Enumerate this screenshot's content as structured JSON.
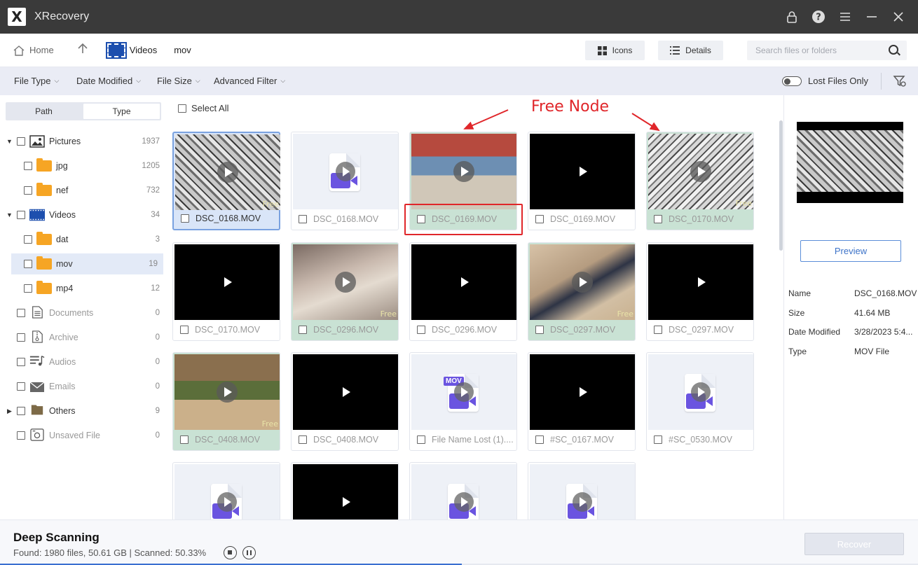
{
  "app": {
    "title": "XRecovery",
    "logo_letter": "X"
  },
  "window_controls": [
    "lock-icon",
    "help-icon",
    "menu-icon",
    "minimize-icon",
    "close-icon"
  ],
  "nav": {
    "home_label": "Home",
    "breadcrumb": [
      "Videos",
      "mov"
    ],
    "icons_view_label": "Icons",
    "details_view_label": "Details",
    "search_placeholder": "Search files or folders"
  },
  "filters": {
    "file_type": "File Type",
    "date_modified": "Date Modified",
    "file_size": "File Size",
    "advanced": "Advanced Filter",
    "lost_files_only": "Lost Files Only",
    "lost_files_only_enabled": false
  },
  "sidebar": {
    "segments": [
      "Path",
      "Type"
    ],
    "active_segment": "Type",
    "tree": [
      {
        "label": "Pictures",
        "count": "1937",
        "icon": "picture-icon",
        "level": 0,
        "expanded": true
      },
      {
        "label": "jpg",
        "count": "1205",
        "icon": "folder-icon",
        "level": 1
      },
      {
        "label": "nef",
        "count": "732",
        "icon": "folder-icon",
        "level": 1
      },
      {
        "label": "Videos",
        "count": "34",
        "icon": "video-icon",
        "level": 0,
        "expanded": true
      },
      {
        "label": "dat",
        "count": "3",
        "icon": "folder-icon",
        "level": 1
      },
      {
        "label": "mov",
        "count": "19",
        "icon": "folder-icon",
        "level": 1,
        "selected": true
      },
      {
        "label": "mp4",
        "count": "12",
        "icon": "folder-icon",
        "level": 1
      },
      {
        "label": "Documents",
        "count": "0",
        "icon": "document-icon",
        "level": 0,
        "dim": true
      },
      {
        "label": "Archive",
        "count": "0",
        "icon": "archive-icon",
        "level": 0,
        "dim": true
      },
      {
        "label": "Audios",
        "count": "0",
        "icon": "audio-icon",
        "level": 0,
        "dim": true
      },
      {
        "label": "Emails",
        "count": "0",
        "icon": "email-icon",
        "level": 0,
        "dim": true
      },
      {
        "label": "Others",
        "count": "9",
        "icon": "others-icon",
        "level": 0,
        "expandable": true
      },
      {
        "label": "Unsaved File",
        "count": "0",
        "icon": "unsaved-icon",
        "level": 0,
        "dim": true
      }
    ]
  },
  "grid": {
    "select_all_label": "Select All",
    "free_tag": "Free",
    "mov_badge": "MOV",
    "cards": [
      {
        "name": "DSC_0168.MOV",
        "thumb": "manga",
        "free": false,
        "selected": true,
        "free_tag": true
      },
      {
        "name": "DSC_0168.MOV",
        "thumb": "file",
        "free": false
      },
      {
        "name": "DSC_0169.MOV",
        "thumb": "naruto",
        "free": true
      },
      {
        "name": "DSC_0169.MOV",
        "thumb": "black",
        "free": false
      },
      {
        "name": "DSC_0170.MOV",
        "thumb": "manga2",
        "free": true,
        "free_tag": true
      },
      {
        "name": "DSC_0170.MOV",
        "thumb": "black",
        "free": false
      },
      {
        "name": "DSC_0296.MOV",
        "thumb": "sepia",
        "free": true,
        "free_tag": true
      },
      {
        "name": "DSC_0296.MOV",
        "thumb": "black",
        "free": false
      },
      {
        "name": "DSC_0297.MOV",
        "thumb": "sasuke",
        "free": true,
        "free_tag": true
      },
      {
        "name": "DSC_0297.MOV",
        "thumb": "black",
        "free": false
      },
      {
        "name": "DSC_0408.MOV",
        "thumb": "forest",
        "free": true,
        "free_tag": true
      },
      {
        "name": "DSC_0408.MOV",
        "thumb": "black",
        "free": false
      },
      {
        "name": "File Name Lost (1)....",
        "thumb": "movfile",
        "free": false
      },
      {
        "name": "#SC_0167.MOV",
        "thumb": "black",
        "free": false
      },
      {
        "name": "#SC_0530.MOV",
        "thumb": "file",
        "free": false
      },
      {
        "name": "",
        "thumb": "file",
        "free": false
      },
      {
        "name": "",
        "thumb": "black",
        "free": false
      },
      {
        "name": "",
        "thumb": "file",
        "free": false
      },
      {
        "name": "",
        "thumb": "file",
        "free": false
      }
    ]
  },
  "annotation": {
    "label": "Free Node",
    "color": "#e0262a"
  },
  "details": {
    "preview_label": "Preview",
    "rows": [
      {
        "key": "Name",
        "value": "DSC_0168.MOV"
      },
      {
        "key": "Size",
        "value": "41.64 MB"
      },
      {
        "key": "Date Modified",
        "value": "3/28/2023 5:4..."
      },
      {
        "key": "Type",
        "value": "MOV File"
      }
    ]
  },
  "status": {
    "title": "Deep Scanning",
    "found_text": "Found: 1980 files, 50.61 GB  |  Scanned: 50.33%",
    "progress": 0.5033,
    "recover_label": "Recover"
  },
  "colors": {
    "accent": "#3a6fd0",
    "free_bg": "#c9e2d4",
    "selected_bg": "#d9e5f8",
    "titlebar": "#3a3a3a"
  }
}
